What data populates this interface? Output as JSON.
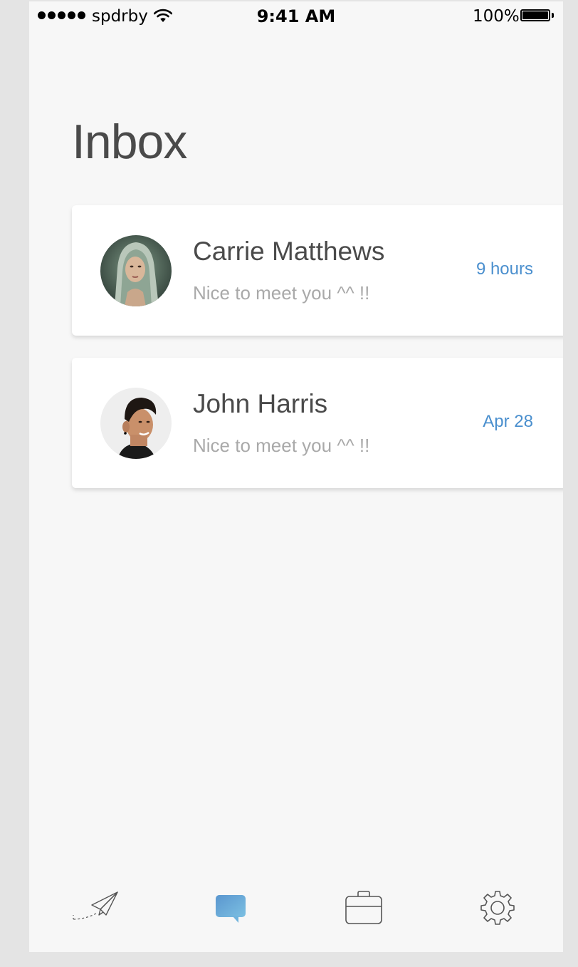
{
  "status_bar": {
    "carrier": "spdrby",
    "time": "9:41 AM",
    "battery": "100%"
  },
  "page": {
    "title": "Inbox"
  },
  "messages": [
    {
      "sender": "Carrie Matthews",
      "snippet": "Nice to meet you ^^ !!",
      "time": "9  hours",
      "avatar": "woman-headscarf-avatar"
    },
    {
      "sender": "John Harris",
      "snippet": "Nice to meet you ^^ !!",
      "time": "Apr 28",
      "avatar": "man-avatar"
    }
  ],
  "tab_bar": {
    "items": [
      {
        "icon": "paper-plane-icon",
        "active": false
      },
      {
        "icon": "chat-bubble-icon",
        "active": true
      },
      {
        "icon": "briefcase-icon",
        "active": false
      },
      {
        "icon": "gear-icon",
        "active": false
      }
    ]
  },
  "colors": {
    "accent": "#4a8fce",
    "active_tab": "#6aaad8",
    "title": "#4a4a4a",
    "snippet": "#a9a9a9",
    "background": "#f7f7f7"
  }
}
